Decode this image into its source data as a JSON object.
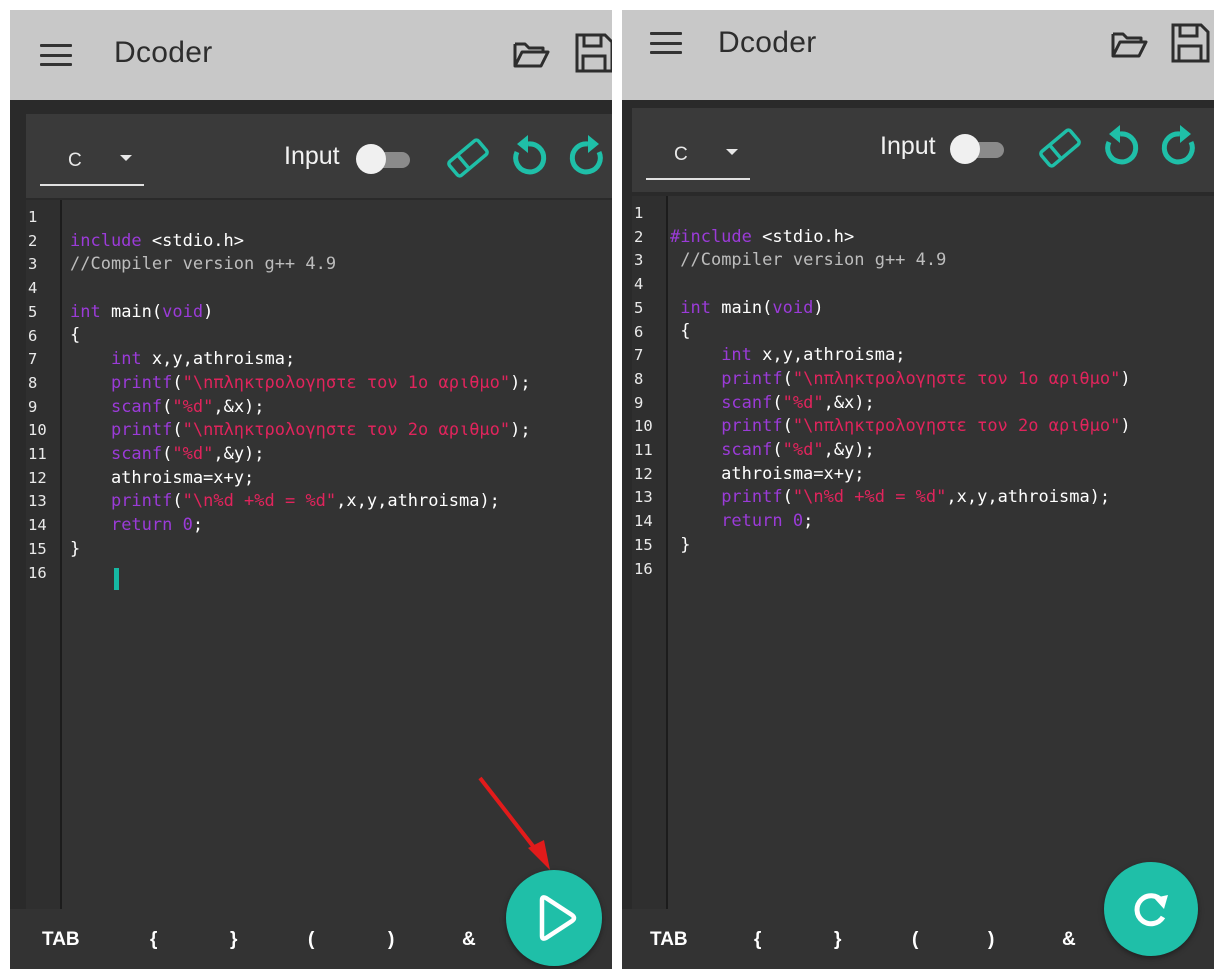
{
  "app": {
    "title": "Dcoder"
  },
  "toolbar": {
    "language": "C",
    "input_label": "Input"
  },
  "code": {
    "line_numbers": [
      "1",
      "2",
      "3",
      "4",
      "5",
      "6",
      "7",
      "8",
      "9",
      "10",
      "11",
      "12",
      "13",
      "14",
      "15",
      "16"
    ]
  },
  "keys": [
    "TAB",
    "{",
    "}",
    "(",
    ")",
    "&"
  ],
  "icons": {
    "menu": "menu-icon",
    "folder": "folder-open-icon",
    "save": "save-icon",
    "eraser": "eraser-icon",
    "undo": "undo-icon",
    "redo": "redo-icon",
    "run": "play-icon",
    "refresh": "refresh-icon",
    "annotation": "red-arrow"
  },
  "colors": {
    "accent": "#1fbfa8",
    "appbar": "#c8c8c8",
    "editor_bg": "#333333",
    "keyword": "#9b3bd8",
    "string": "#e0245c",
    "annotation_arrow": "#e11b1b"
  }
}
